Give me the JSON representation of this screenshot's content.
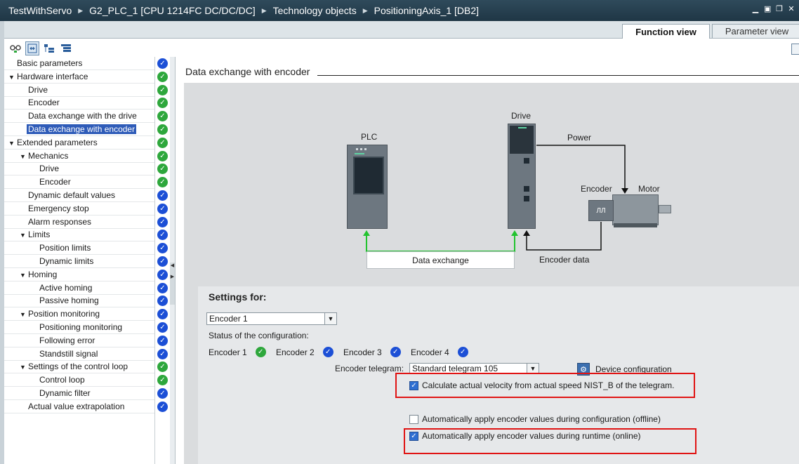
{
  "titlebar": {
    "crumbs": [
      "TestWithServo",
      "G2_PLC_1 [CPU 1214FC DC/DC/DC]",
      "Technology objects",
      "PositioningAxis_1 [DB2]"
    ],
    "controls": [
      "▁",
      "▣",
      "❐",
      "✕"
    ]
  },
  "tabs": {
    "function_view": "Function view",
    "parameter_view": "Parameter view"
  },
  "nav": [
    {
      "label": "Basic parameters",
      "indent": 0,
      "expand": "",
      "status": "blue"
    },
    {
      "label": "Hardware interface",
      "indent": 0,
      "expand": "▼",
      "status": "green"
    },
    {
      "label": "Drive",
      "indent": 1,
      "expand": "",
      "status": "green"
    },
    {
      "label": "Encoder",
      "indent": 1,
      "expand": "",
      "status": "green"
    },
    {
      "label": "Data exchange with the drive",
      "indent": 1,
      "expand": "",
      "status": "green"
    },
    {
      "label": "Data exchange with encoder",
      "indent": 1,
      "expand": "",
      "status": "green",
      "selected": true
    },
    {
      "label": "Extended parameters",
      "indent": 0,
      "expand": "▼",
      "status": "green"
    },
    {
      "label": "Mechanics",
      "indent": 1,
      "expand": "▼",
      "status": "green"
    },
    {
      "label": "Drive",
      "indent": 2,
      "expand": "",
      "status": "green"
    },
    {
      "label": "Encoder",
      "indent": 2,
      "expand": "",
      "status": "green"
    },
    {
      "label": "Dynamic default values",
      "indent": 1,
      "expand": "",
      "status": "blue"
    },
    {
      "label": "Emergency stop",
      "indent": 1,
      "expand": "",
      "status": "blue"
    },
    {
      "label": "Alarm responses",
      "indent": 1,
      "expand": "",
      "status": "blue"
    },
    {
      "label": "Limits",
      "indent": 1,
      "expand": "▼",
      "status": "blue"
    },
    {
      "label": "Position limits",
      "indent": 2,
      "expand": "",
      "status": "blue"
    },
    {
      "label": "Dynamic limits",
      "indent": 2,
      "expand": "",
      "status": "blue"
    },
    {
      "label": "Homing",
      "indent": 1,
      "expand": "▼",
      "status": "blue"
    },
    {
      "label": "Active homing",
      "indent": 2,
      "expand": "",
      "status": "blue"
    },
    {
      "label": "Passive homing",
      "indent": 2,
      "expand": "",
      "status": "blue"
    },
    {
      "label": "Position monitoring",
      "indent": 1,
      "expand": "▼",
      "status": "blue"
    },
    {
      "label": "Positioning monitoring",
      "indent": 2,
      "expand": "",
      "status": "blue"
    },
    {
      "label": "Following error",
      "indent": 2,
      "expand": "",
      "status": "blue"
    },
    {
      "label": "Standstill signal",
      "indent": 2,
      "expand": "",
      "status": "blue"
    },
    {
      "label": "Settings of the control loop",
      "indent": 1,
      "expand": "▼",
      "status": "green"
    },
    {
      "label": "Control loop",
      "indent": 2,
      "expand": "",
      "status": "green"
    },
    {
      "label": "Dynamic filter",
      "indent": 2,
      "expand": "",
      "status": "blue"
    },
    {
      "label": "Actual value extrapolation",
      "indent": 1,
      "expand": "",
      "status": "blue"
    }
  ],
  "section_title": "Data exchange with encoder",
  "diagram": {
    "plc": "PLC",
    "drive": "Drive",
    "power": "Power",
    "encoder": "Encoder",
    "motor": "Motor",
    "data_exchange": "Data exchange",
    "encoder_data": "Encoder data",
    "encoder_glyph": "ЛЛ"
  },
  "settings": {
    "title": "Settings for:",
    "encoder_select": "Encoder 1",
    "status_label": "Status of the configuration:",
    "encoders": [
      {
        "label": "Encoder 1",
        "status": "green"
      },
      {
        "label": "Encoder 2",
        "status": "blue"
      },
      {
        "label": "Encoder 3",
        "status": "blue"
      },
      {
        "label": "Encoder 4",
        "status": "blue"
      }
    ],
    "telegram_label": "Encoder telegram:",
    "telegram_value": "Standard telegram 105",
    "device_config": "Device configuration",
    "chk_velocity": {
      "label": "Calculate actual velocity from actual speed NIST_B of the telegram.",
      "checked": true
    },
    "chk_offline": {
      "label": "Automatically apply encoder values during configuration (offline)",
      "checked": false
    },
    "chk_online": {
      "label": "Automatically apply encoder values during runtime (online)",
      "checked": true
    }
  },
  "colors": {
    "status_green": "#2ea73c",
    "status_blue": "#1c4fd6",
    "highlight_red": "#e01414",
    "wire_green": "#22c32f"
  }
}
